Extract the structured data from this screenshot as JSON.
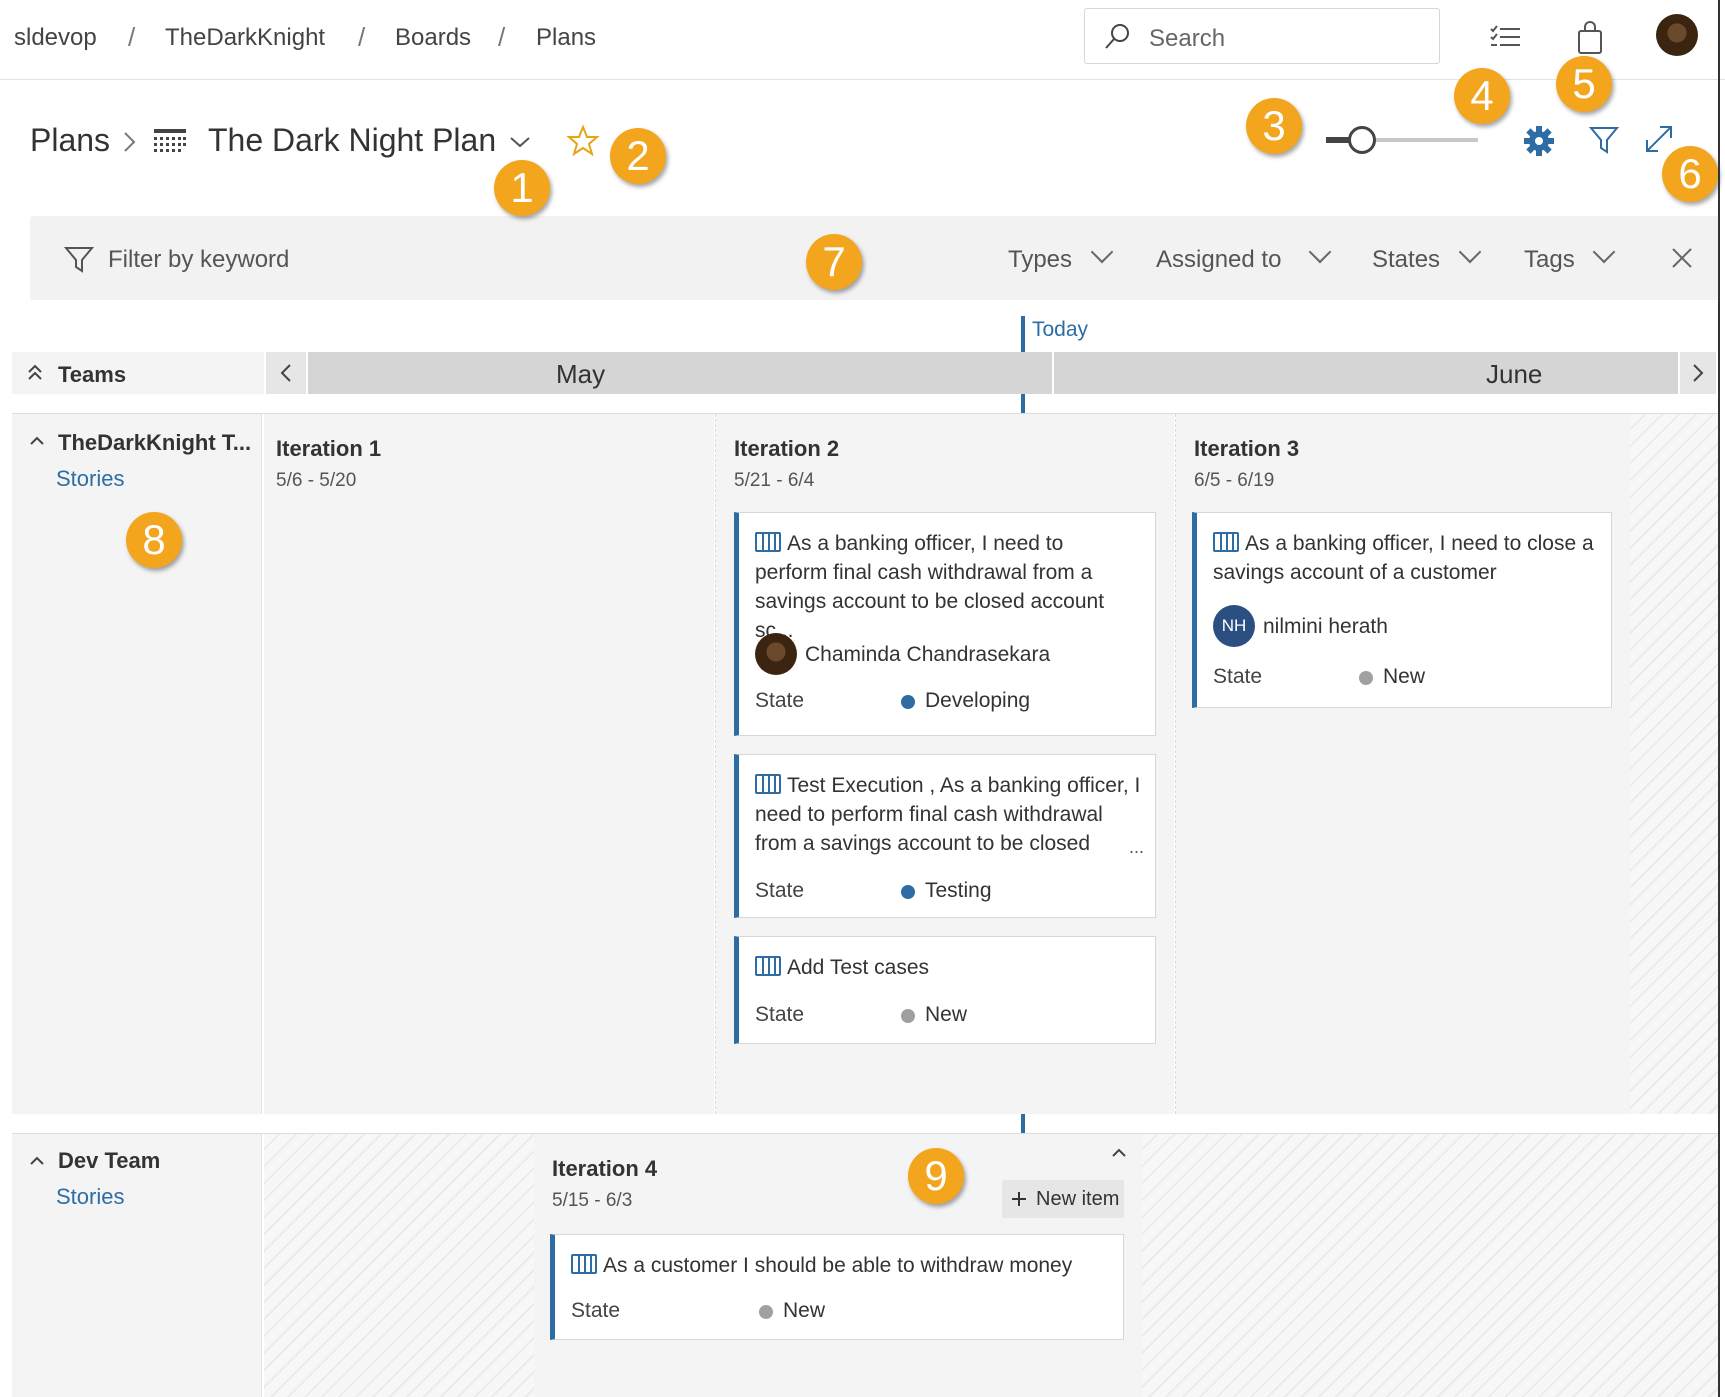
{
  "breadcrumb": [
    "sldevop",
    "TheDarkKnight",
    "Boards",
    "Plans"
  ],
  "search": {
    "placeholder": "Search"
  },
  "header": {
    "section": "Plans",
    "plan_name": "The Dark Night Plan"
  },
  "callouts": [
    "1",
    "2",
    "3",
    "4",
    "5",
    "6",
    "7",
    "8",
    "9"
  ],
  "filter": {
    "placeholder": "Filter by keyword",
    "dropdowns": [
      "Types",
      "Assigned to",
      "States",
      "Tags"
    ]
  },
  "timeline": {
    "today_label": "Today",
    "teams_label": "Teams",
    "months": [
      "May",
      "June"
    ]
  },
  "teams": [
    {
      "name": "TheDarkKnight T...",
      "sub": "Stories",
      "iterations": [
        {
          "title": "Iteration 1",
          "dates": "5/6 - 5/20",
          "cards": []
        },
        {
          "title": "Iteration 2",
          "dates": "5/21 - 6/4",
          "cards": [
            {
              "lines": [
                "As a banking officer, I need to",
                "perform final cash withdrawal from a",
                "savings account to be closed account sc..."
              ],
              "assignee": "Chaminda Chandrasekara",
              "state_label": "State",
              "state": "Developing"
            },
            {
              "lines": [
                "Test Execution , As a banking officer, I",
                "need to perform final cash withdrawal",
                "from a savings account to be closed"
              ],
              "ellipsis": "...",
              "state_label": "State",
              "state": "Testing"
            },
            {
              "lines": [
                "Add Test cases"
              ],
              "state_label": "State",
              "state": "New"
            }
          ]
        },
        {
          "title": "Iteration 3",
          "dates": "6/5 - 6/19",
          "cards": [
            {
              "lines": [
                "As a banking officer, I need to close a",
                "savings account of a customer"
              ],
              "assignee_initials": "NH",
              "assignee": "nilmini herath",
              "state_label": "State",
              "state": "New"
            }
          ]
        }
      ]
    },
    {
      "name": "Dev Team",
      "sub": "Stories",
      "iterations": [
        {
          "title": "Iteration 4",
          "dates": "5/15 - 6/3",
          "new_item": "New item",
          "cards": [
            {
              "lines": [
                "As a customer I should be able to withdraw money"
              ],
              "state_label": "State",
              "state": "New"
            }
          ]
        }
      ]
    }
  ],
  "colors": {
    "accent": "#2e6da4",
    "callout": "#f3a51d",
    "state_active": "#2e6da4",
    "state_new": "#a0a0a0"
  }
}
